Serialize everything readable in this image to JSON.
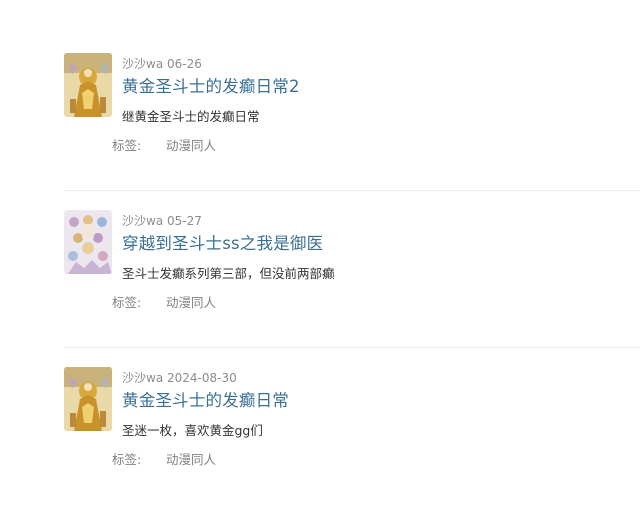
{
  "entries": [
    {
      "cover_icon": "gold-saint-cover-image",
      "author": "沙沙wa",
      "date": "06-26",
      "title": "黄金圣斗士的发癫日常2",
      "description": "继黄金圣斗士的发癫日常",
      "tag_label": "标签:",
      "tags": [
        "动漫同人"
      ]
    },
    {
      "cover_icon": "group-illustration-cover-image",
      "author": "沙沙wa",
      "date": "05-27",
      "title": "穿越到圣斗士ss之我是御医",
      "description": "圣斗士发癫系列第三部，但没前两部癫",
      "tag_label": "标签:",
      "tags": [
        "动漫同人"
      ]
    },
    {
      "cover_icon": "gold-saint-cover-image",
      "author": "沙沙wa",
      "date": "2024-08-30",
      "title": "黄金圣斗士的发癫日常",
      "description": "圣迷一枚，喜欢黄金gg们",
      "tag_label": "标签:",
      "tags": [
        "动漫同人"
      ]
    }
  ]
}
